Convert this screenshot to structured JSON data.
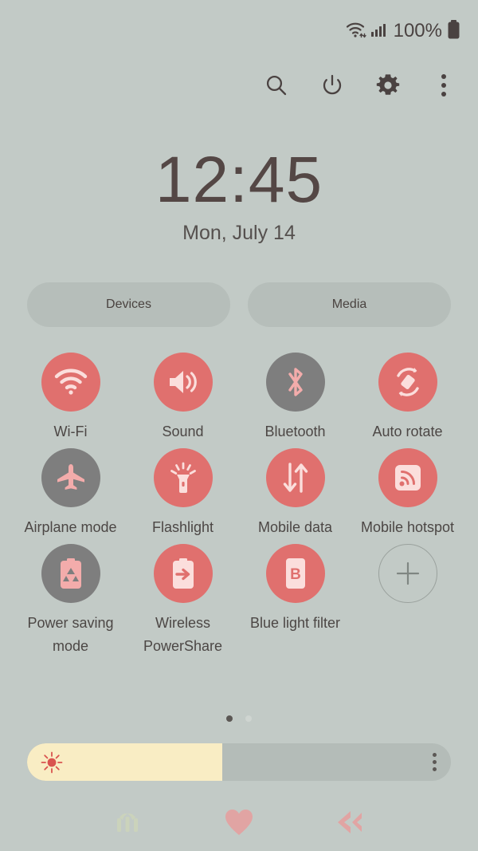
{
  "status_bar": {
    "wifi_icon": "wifi-data-icon",
    "signal_icon": "cellular-signal-icon",
    "battery_percent": "100%",
    "battery_icon": "battery-full-icon"
  },
  "toolbar": {
    "items": [
      {
        "name": "search-icon",
        "label": "Search"
      },
      {
        "name": "power-icon",
        "label": "Power"
      },
      {
        "name": "settings-gear-icon",
        "label": "Settings"
      },
      {
        "name": "overflow-menu-icon",
        "label": "More options"
      }
    ]
  },
  "clock": {
    "time": "12:45",
    "date": "Mon, July 14"
  },
  "pills": [
    {
      "label": "Devices"
    },
    {
      "label": "Media"
    }
  ],
  "tiles": [
    [
      {
        "label": "Wi-Fi",
        "icon": "wifi-icon",
        "state": "on"
      },
      {
        "label": "Sound",
        "icon": "sound-speaker-icon",
        "state": "on"
      },
      {
        "label": "Bluetooth",
        "icon": "bluetooth-icon",
        "state": "off"
      },
      {
        "label": "Auto rotate",
        "icon": "auto-rotate-icon",
        "state": "on"
      }
    ],
    [
      {
        "label": "Airplane mode",
        "icon": "airplane-icon",
        "state": "off"
      },
      {
        "label": "Flashlight",
        "icon": "flashlight-icon",
        "state": "on"
      },
      {
        "label": "Mobile data",
        "icon": "mobile-data-icon",
        "state": "on"
      },
      {
        "label": "Mobile hotspot",
        "icon": "mobile-hotspot-icon",
        "state": "on"
      }
    ],
    [
      {
        "label": "Power saving mode",
        "icon": "power-saving-icon",
        "state": "off"
      },
      {
        "label": "Wireless PowerShare",
        "icon": "wireless-powershare-icon",
        "state": "on"
      },
      {
        "label": "Blue light filter",
        "icon": "blue-light-filter-icon",
        "state": "on"
      },
      {
        "label": "",
        "icon": "add-tile-icon",
        "state": "add"
      }
    ]
  ],
  "page_indicator": {
    "total": 2,
    "active": 1
  },
  "brightness": {
    "level_percent": 46,
    "icon": "brightness-sun-icon",
    "menu_icon": "brightness-options-icon"
  },
  "navbar": [
    {
      "name": "recents-button",
      "icon": "recents-icon"
    },
    {
      "name": "home-button",
      "icon": "home-heart-icon"
    },
    {
      "name": "back-button",
      "icon": "back-chevron-icon"
    }
  ],
  "colors": {
    "background": "#c2cac6",
    "tile_on": "#e0706e",
    "tile_off": "#7e7e7e",
    "icon_light": "#fbdedc",
    "text": "#4c4745",
    "brightness_fill": "#f9edc4"
  }
}
